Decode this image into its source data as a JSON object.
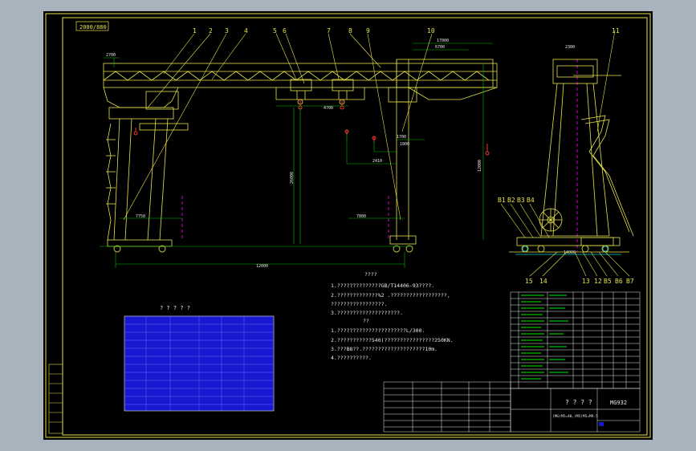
{
  "title_tag": "2000/880",
  "callouts_top": [
    "1",
    "2",
    "3",
    "4",
    "5",
    "6",
    "7",
    "8",
    "9",
    "10",
    "11"
  ],
  "callouts_bottom": [
    "B1",
    "B2",
    "B3",
    "B4",
    "15",
    "14",
    "13",
    "12",
    "B5",
    "B6",
    "B7"
  ],
  "dimensions": {
    "top_left": "2700",
    "upper_right_a": "17000",
    "upper_right_b": "6700",
    "side_top": "2300",
    "trolley_span": "4700",
    "height_main": "26000",
    "rail_span": "12000",
    "inner_a": "1700",
    "inner_b": "2410",
    "inner_c": "1800",
    "left_under": "7750",
    "right_under": "7800",
    "right_height": "12000",
    "right_base": "14000"
  },
  "notes": {
    "heading": "????",
    "lines": [
      "1.??????????????GB/T14406-93????.",
      "2.?????????????%2 .??????????????????,",
      "  ?????????????????.",
      "3.????????????????????.",
      "??",
      "1.??????????????????????L/300.",
      "2.???????????540(????????????????250KN.",
      "3.???B8??.????????????????????10m.",
      "4.??????????."
    ]
  },
  "param_table_title": "? ? ? ? ?",
  "title_block": {
    "name": "? ? ? ?",
    "code": "MG932",
    "sub": "(MG)M5=40,(M5)M5=M9.5"
  },
  "colors": {
    "background": "#a8b3bd",
    "sheet": "#000000",
    "structure": "#e6e24a",
    "dims": "#e8e8e8",
    "green": "#00c000",
    "magenta": "#ff00ff",
    "red": "#ff3030",
    "table_blue": "#1818d0",
    "cyan": "#00d0d0"
  }
}
